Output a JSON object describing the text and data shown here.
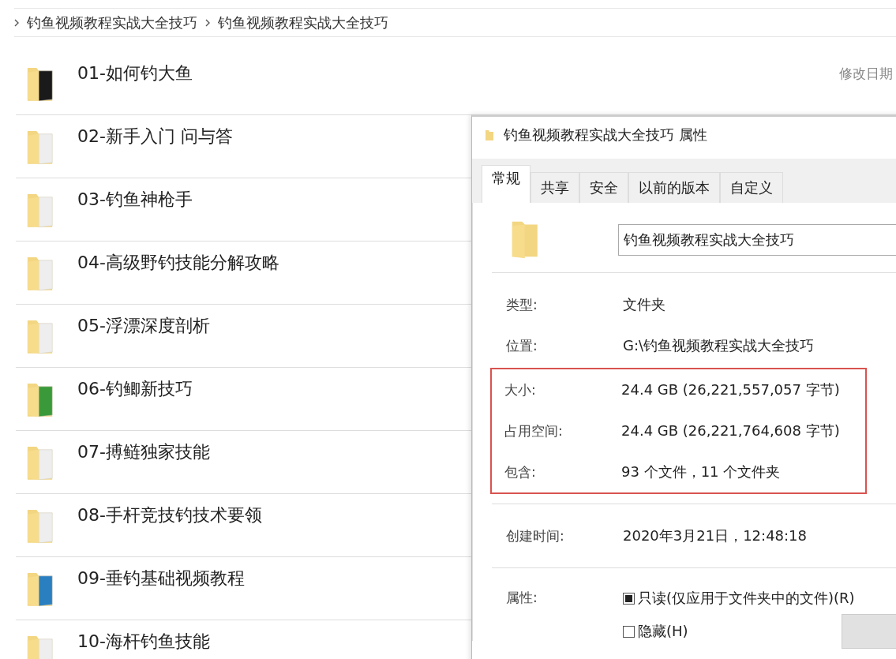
{
  "breadcrumb": [
    "钓鱼视频教程实战大全技巧",
    "钓鱼视频教程实战大全技巧"
  ],
  "column_header": "修改日期",
  "folders": [
    {
      "name": "01-如何钓大鱼",
      "color": "#1a1a1a"
    },
    {
      "name": "02-新手入门 问与答",
      "color": "#eeeeee"
    },
    {
      "name": "03-钓鱼神枪手",
      "color": "#eeeeee"
    },
    {
      "name": "04-高级野钓技能分解攻略",
      "color": "#eeeeee"
    },
    {
      "name": "05-浮漂深度剖析",
      "color": "#eeeeee"
    },
    {
      "name": "06-钓鲫新技巧",
      "color": "#3a9a3a"
    },
    {
      "name": "07-搏鲢独家技能",
      "color": "#eeeeee"
    },
    {
      "name": "08-手杆竞技钓技术要领",
      "color": "#eeeeee"
    },
    {
      "name": "09-垂钓基础视频教程",
      "color": "#2a7fc0"
    },
    {
      "name": "10-海杆钓鱼技能",
      "color": "#eeeeee"
    }
  ],
  "dialog": {
    "title": "钓鱼视频教程实战大全技巧 属性",
    "tabs": [
      {
        "label": "常规",
        "selected": true
      },
      {
        "label": "共享",
        "selected": false
      },
      {
        "label": "安全",
        "selected": false
      },
      {
        "label": "以前的版本",
        "selected": false
      },
      {
        "label": "自定义",
        "selected": false
      }
    ],
    "name_field": {
      "value": "钓鱼视频教程实战大全技巧"
    },
    "sections": [
      {
        "highlighted": false,
        "rows": [
          {
            "label": "类型:",
            "value": "文件夹"
          },
          {
            "label": "位置:",
            "value": "G:\\钓鱼视频教程实战大全技巧"
          }
        ]
      },
      {
        "highlighted": true,
        "rows": [
          {
            "label": "大小:",
            "value": "24.4 GB (26,221,557,057 字节)"
          },
          {
            "label": "占用空间:",
            "value": "24.4 GB (26,221,764,608 字节)"
          },
          {
            "label": "包含:",
            "value": "93 个文件，11 个文件夹"
          }
        ]
      },
      {
        "highlighted": false,
        "rows": [
          {
            "label": "创建时间:",
            "value": "2020年3月21日，12:48:18"
          }
        ]
      }
    ],
    "attributes": {
      "label": "属性:",
      "options": [
        {
          "label": "只读(仅应用于文件夹中的文件)(R)",
          "checked": false,
          "indeterminate": true
        },
        {
          "label": "隐藏(H)",
          "checked": false,
          "indeterminate": false
        }
      ]
    }
  }
}
